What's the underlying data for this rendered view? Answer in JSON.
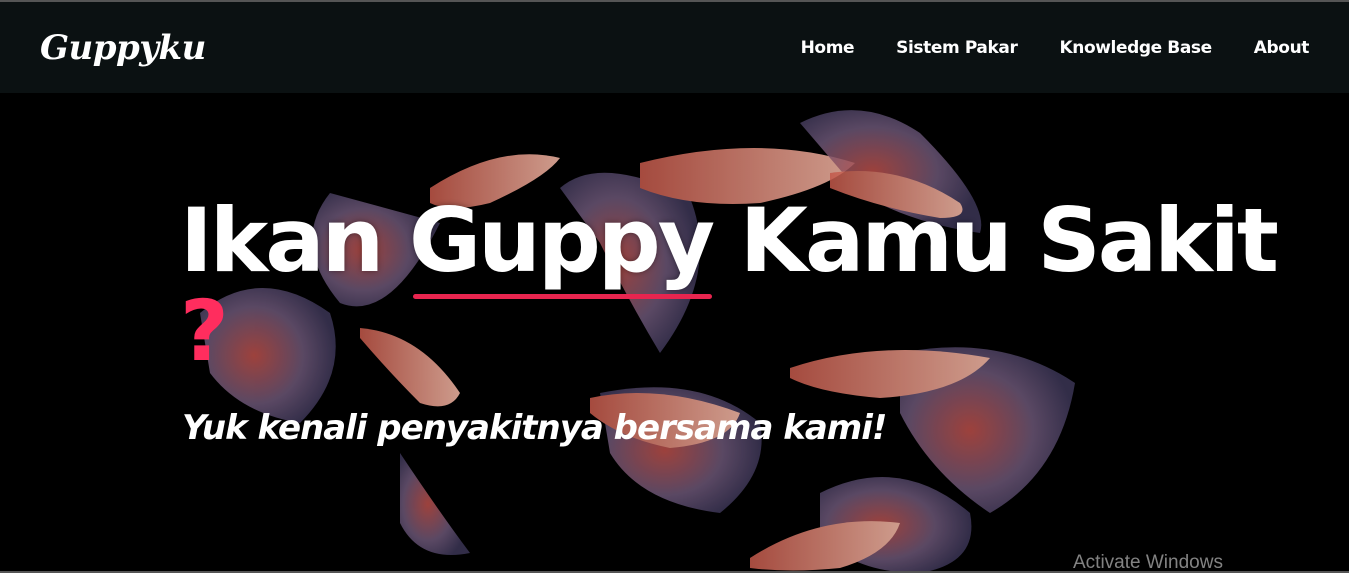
{
  "navbar": {
    "brand": "Guppyku",
    "links": [
      {
        "label": "Home"
      },
      {
        "label": "Sistem Pakar"
      },
      {
        "label": "Knowledge Base"
      },
      {
        "label": "About"
      }
    ]
  },
  "hero": {
    "title_before": "Ikan ",
    "title_highlight": "Guppy",
    "title_after": " Kamu Sakit",
    "question_mark": "?",
    "subtitle": "Yuk kenali penyakitnya bersama kami!"
  },
  "overlay": {
    "watermark": "Activate Windows"
  },
  "colors": {
    "navbar_bg": "#0b1112",
    "accent": "#e8254f",
    "question": "#ff2d5e"
  }
}
